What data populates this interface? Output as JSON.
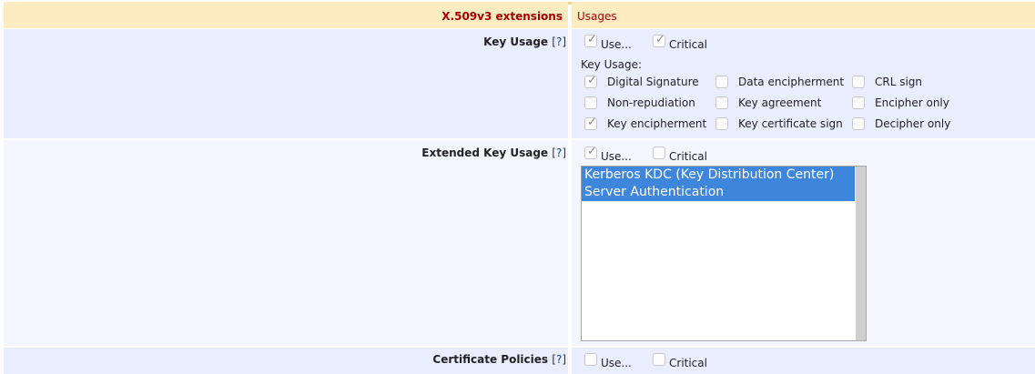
{
  "header": {
    "left": "X.509v3 extensions",
    "right": "Usages"
  },
  "key_usage": {
    "label": "Key Usage",
    "help": "?",
    "use_label": "Use...",
    "critical_label": "Critical",
    "sub_label": "Key Usage:",
    "options": {
      "digital_signature": "Digital Signature",
      "data_encipherment": "Data encipherment",
      "crl_sign": "CRL sign",
      "non_repudiation": "Non-repudiation",
      "key_agreement": "Key agreement",
      "encipher_only": "Encipher only",
      "key_encipherment": "Key encipherment",
      "key_cert_sign": "Key certificate sign",
      "decipher_only": "Decipher only"
    }
  },
  "extended_key_usage": {
    "label": "Extended Key Usage",
    "help": "?",
    "use_label": "Use...",
    "critical_label": "Critical",
    "selected_items": [
      "Kerberos KDC (Key Distribution Center)",
      "Server Authentication"
    ]
  },
  "certificate_policies": {
    "label": "Certificate Policies",
    "help": "?",
    "use_label": "Use...",
    "critical_label": "Critical"
  },
  "colors": {
    "header_bg": "#fdebc2",
    "header_text": "#a80000",
    "row_bg_dark": "#e9eeff",
    "row_bg_light": "#f3f6fe",
    "selection": "#3d86dc"
  },
  "state": {
    "ku_use": true,
    "ku_critical": true,
    "digital_signature": true,
    "key_encipherment": true,
    "eku_use": true,
    "eku_critical": false,
    "cp_use": false,
    "cp_critical": false
  }
}
